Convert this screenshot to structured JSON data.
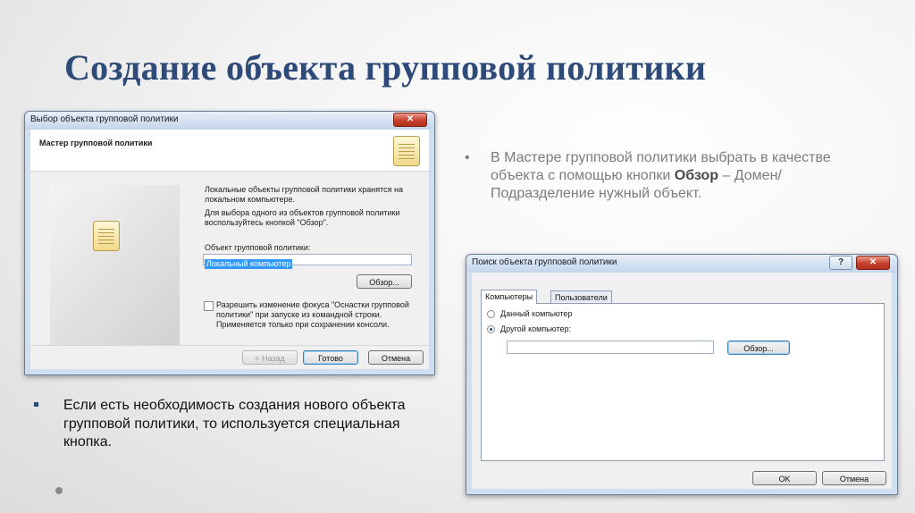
{
  "slide": {
    "title": "Создание объекта групповой политики",
    "bullet_right_pre": "В Мастере групповой политики выбрать в качестве объекта с помощью кнопки",
    "bullet_right_bold": "Обзор",
    "bullet_right_post": "– Домен/Подразделение нужный объект.",
    "bullet_left": "Если есть необходимость создания нового объекта групповой политики, то используется специальная кнопка.",
    "bullet_dot": "•"
  },
  "dialog1": {
    "title": "Выбор объекта групповой политики",
    "header": "Мастер групповой политики",
    "desc1": "Локальные объекты групповой политики хранятся на локальном компьютере.",
    "desc2": "Для выбора одного из объектов групповой политики воспользуйтесь кнопкой \"Обзор\".",
    "field_label": "Объект групповой политики:",
    "field_value": "Локальный компьютер",
    "browse_label": "Обзор...",
    "checkbox_label": "Разрешить изменение фокуса \"Оснастки групповой политики\" при запуске из командной строки. Применяется только при сохранении консоли.",
    "back_label": "< Назад",
    "finish_label": "Готово",
    "cancel_label": "Отмена",
    "close_glyph": "✕"
  },
  "dialog2": {
    "title": "Поиск объекта групповой политики",
    "help_glyph": "?",
    "close_glyph": "✕",
    "tabs": [
      "Компьютеры",
      "Пользователи"
    ],
    "radio1": "Данный компьютер",
    "radio2": "Другой компьютер:",
    "computer_value": "",
    "browse_label": "Обзор...",
    "ok_label": "OK",
    "cancel_label": "Отмена"
  }
}
